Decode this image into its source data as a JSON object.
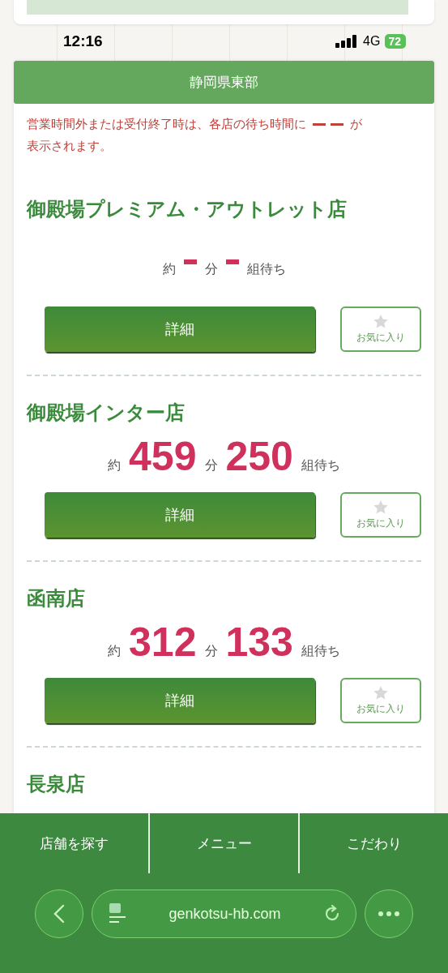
{
  "status_bar": {
    "time": "12:16",
    "network": "4G",
    "battery": "72"
  },
  "region": {
    "title": "静岡県東部"
  },
  "notice": {
    "before": "営業時間外または受付終了時は、各店の待ち時間に",
    "after": "が",
    "line2": "表示されます。"
  },
  "stores": [
    {
      "name": "御殿場プレミアム・アウトレット店",
      "closed": true,
      "prefix": "約",
      "minutes_unit": "分",
      "groups_unit": "組待ち",
      "detail_button": "詳細",
      "favorite_button": "お気に入り",
      "favorite": false
    },
    {
      "name": "御殿場インター店",
      "closed": false,
      "prefix": "約",
      "minutes": "459",
      "minutes_unit": "分",
      "groups": "250",
      "groups_unit": "組待ち",
      "detail_button": "詳細",
      "favorite_button": "お気に入り",
      "favorite": false
    },
    {
      "name": "函南店",
      "closed": false,
      "prefix": "約",
      "minutes": "312",
      "minutes_unit": "分",
      "groups": "133",
      "groups_unit": "組待ち",
      "detail_button": "詳細",
      "favorite_button": "お気に入り",
      "favorite": false
    },
    {
      "name": "長泉店",
      "partial": true
    }
  ],
  "bottom_nav": [
    {
      "label": "店舗を探す"
    },
    {
      "label": "メニュー"
    },
    {
      "label": "こだわり"
    }
  ],
  "browser": {
    "url": "genkotsu-hb.com"
  }
}
